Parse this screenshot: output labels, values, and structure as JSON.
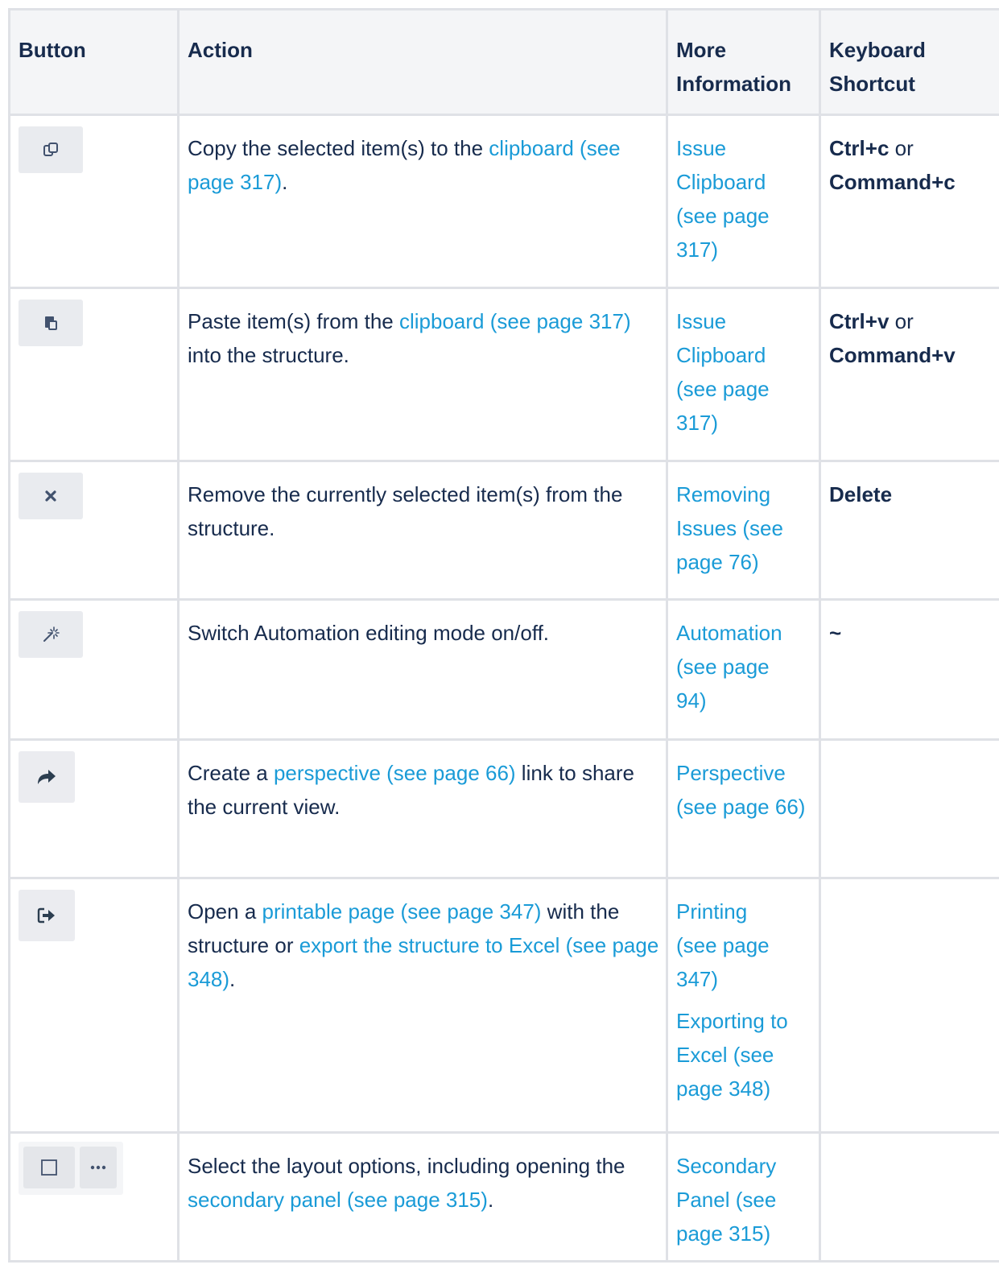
{
  "headers": {
    "button": "Button",
    "action": "Action",
    "more_info_line1": "More",
    "more_info_line2": "Information",
    "shortcut_line1": "Keyboard",
    "shortcut_line2": "Shortcut"
  },
  "rows": [
    {
      "icon": "copy-icon",
      "action_pre": "Copy the selected item(s) to the ",
      "action_link": "clipboard (see page 317)",
      "action_post": ".",
      "more": [
        "Issue Clipboard (see page 317)"
      ],
      "shortcut_a": "Ctrl+c",
      "shortcut_or": " or ",
      "shortcut_b": "Command+c"
    },
    {
      "icon": "paste-icon",
      "action_pre": "Paste item(s) from the ",
      "action_link": "clipboard (see page 317)",
      "action_post": " into the structure.",
      "more": [
        "Issue Clipboard (see page 317)"
      ],
      "shortcut_a": "Ctrl+v",
      "shortcut_or": " or ",
      "shortcut_b": "Command+v"
    },
    {
      "icon": "remove-icon",
      "action_pre": "Remove the currently selected item(s) from the structure.",
      "more": [
        "Removing Issues (see page 76)"
      ],
      "shortcut_a": "Delete"
    },
    {
      "icon": "magic-wand-icon",
      "action_pre": "Switch Automation editing mode on/off.",
      "more": [
        "Automation (see page 94)"
      ],
      "shortcut_a": "~"
    },
    {
      "icon": "share-icon",
      "action_pre": "Create a ",
      "action_link": "perspective (see page 66)",
      "action_post": " link to share the current view.",
      "more": [
        "Perspective (see page 66)"
      ]
    },
    {
      "icon": "export-icon",
      "action_pre": "Open a ",
      "action_link": "printable page (see page 347)",
      "action_mid": " with the structure or ",
      "action_link2": "export the structure to Excel (see page 348)",
      "action_post": ".",
      "more": [
        "Printing (see page 347)",
        "Exporting to Excel (see page 348)"
      ]
    },
    {
      "icon": "layout-icon",
      "icon2": "more-icon",
      "action_pre": "Select the layout options, including opening the ",
      "action_link": "secondary panel (see page 315)",
      "action_post": ".",
      "more": [
        "Secondary Panel (see page 315)"
      ]
    }
  ]
}
